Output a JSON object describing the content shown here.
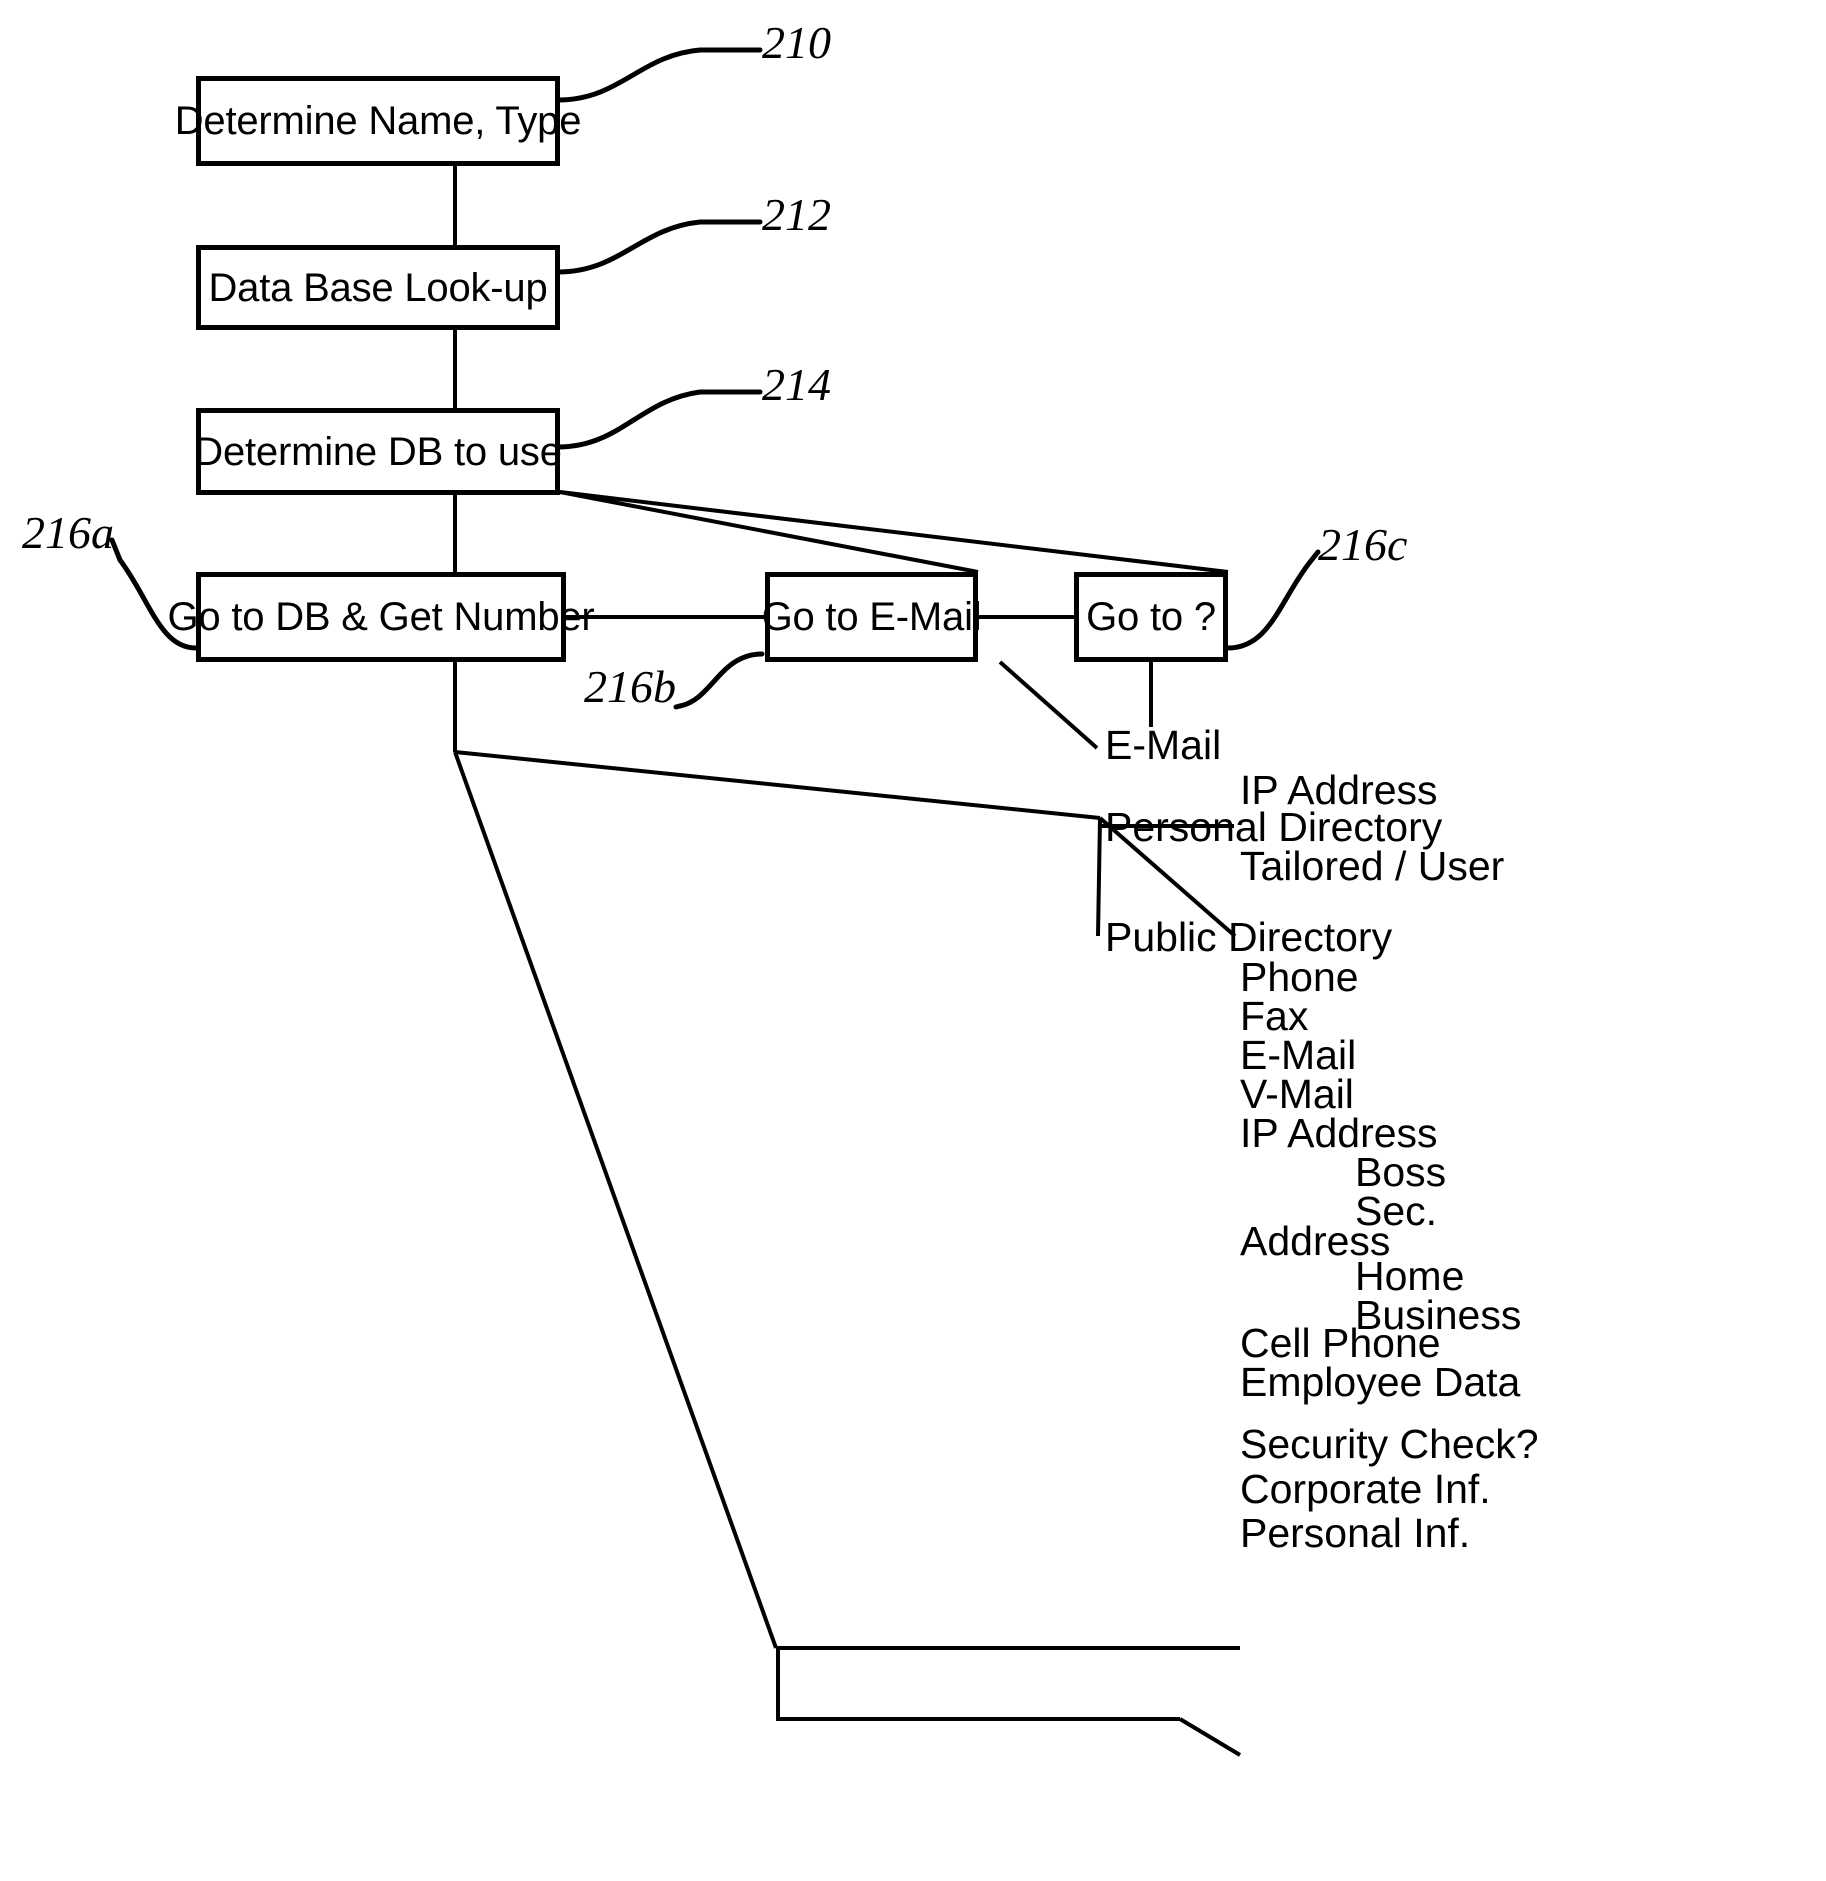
{
  "figure": {
    "kind": "patent-flow-diagram",
    "stroke_color": "#000000",
    "background_color": "#ffffff"
  },
  "nodes": [
    {
      "id": "n210",
      "label": "Determine Name, Type",
      "ref": "210"
    },
    {
      "id": "n212",
      "label": "Data Base Look-up",
      "ref": "212"
    },
    {
      "id": "n214",
      "label": "Determine DB to use",
      "ref": "214"
    },
    {
      "id": "n216a",
      "label": "Go to DB & Get Number",
      "ref": "216a"
    },
    {
      "id": "n216b",
      "label": "Go to E-Mail",
      "ref": "216b"
    },
    {
      "id": "n216c",
      "label": "Go to ?",
      "ref": "216c"
    }
  ],
  "reference_numerals": {
    "n210": "210",
    "n212": "212",
    "n214": "214",
    "n216a": "216a",
    "n216b": "216b",
    "n216c": "216c"
  },
  "leaf_labels": {
    "email_from_goto_q": "E-Mail",
    "ip_address_personal": "IP Address",
    "personal_directory": "Personal Directory",
    "tailored_user": "Tailored / User",
    "public_directory": "Public Directory",
    "phone": "Phone",
    "fax": "Fax",
    "email": "E-Mail",
    "vmail": "V-Mail",
    "ip_address_public": "IP Address",
    "boss": "Boss",
    "sec": "Sec.",
    "address": "Address",
    "home": "Home",
    "business": "Business",
    "cell_phone": "Cell Phone",
    "employee_data": "Employee Data",
    "security_check": "Security Check?",
    "corporate_inf": "Corporate Inf.",
    "personal_inf": "Personal Inf."
  }
}
